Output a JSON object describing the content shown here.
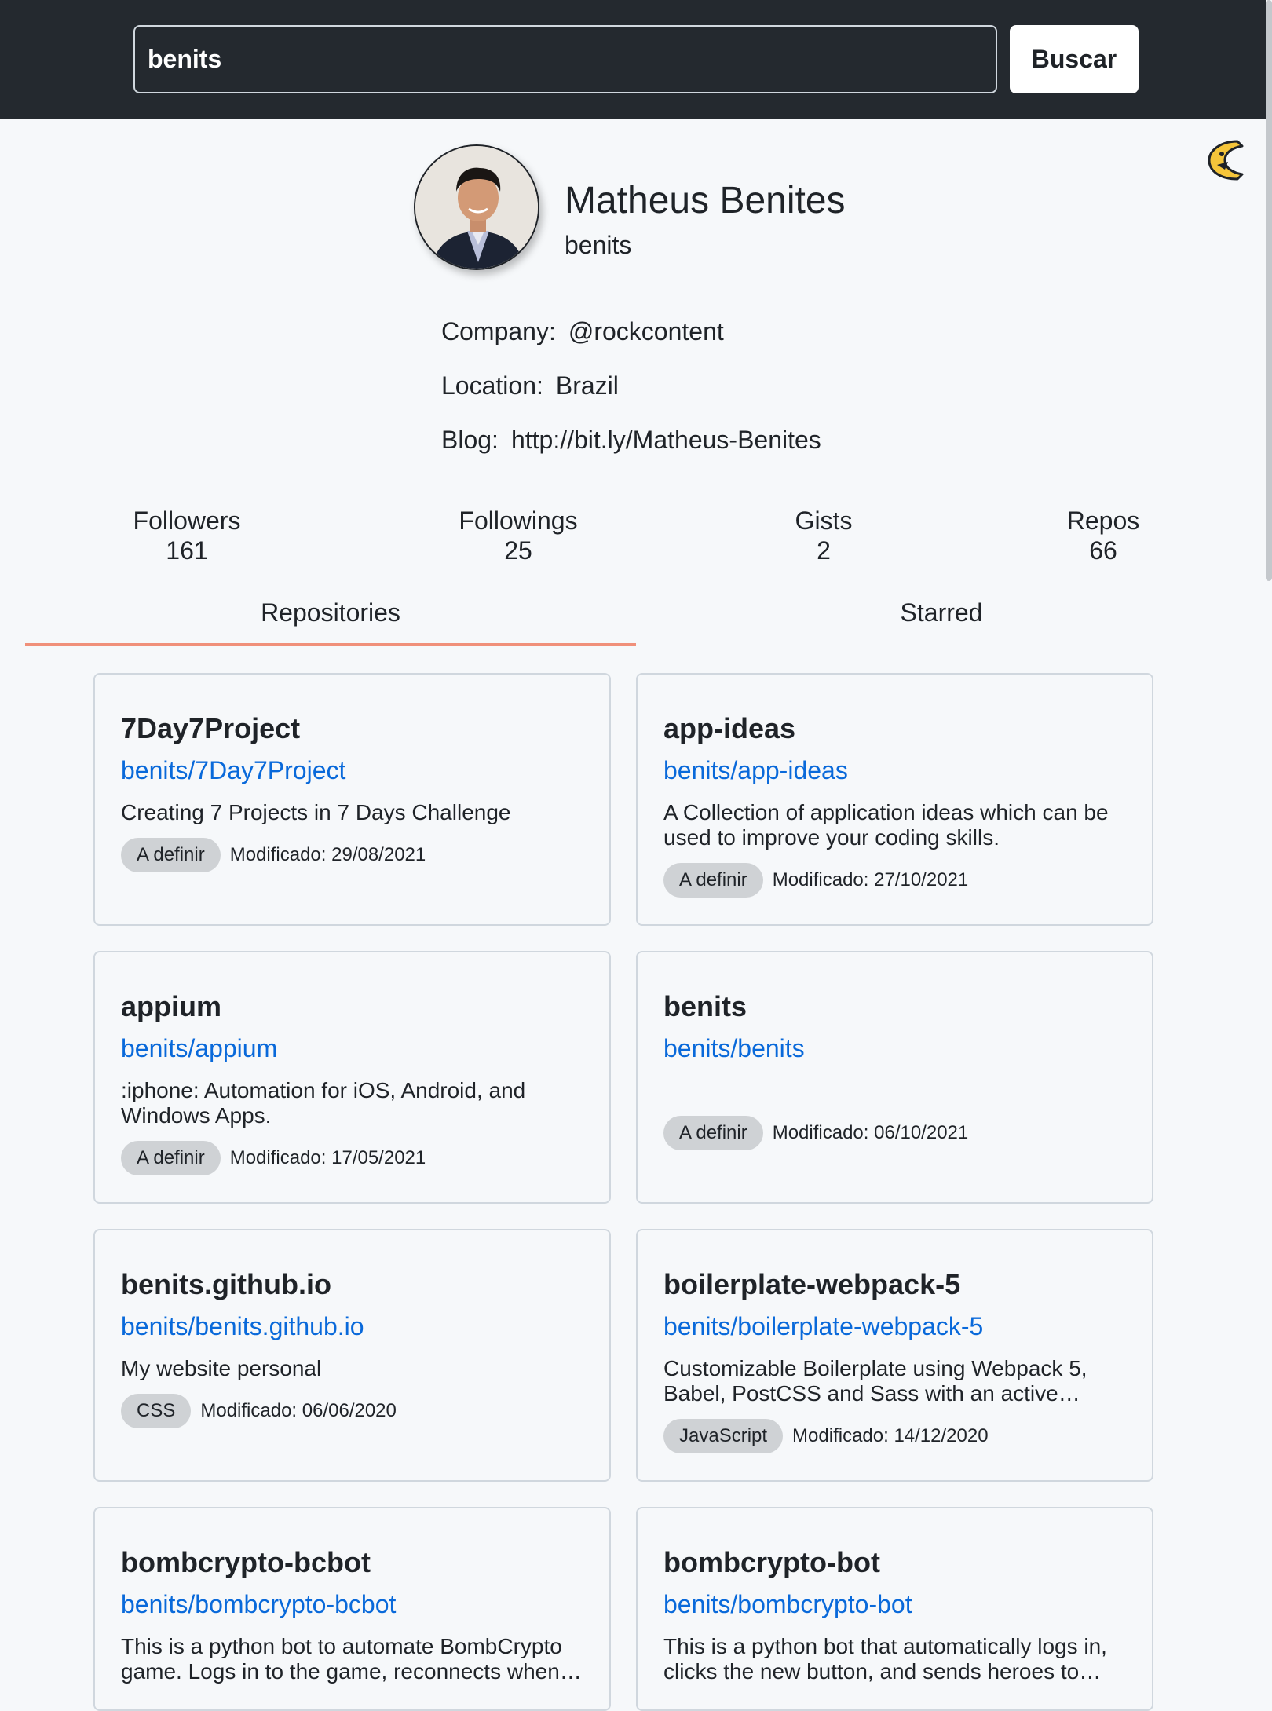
{
  "search": {
    "value": "benits",
    "button_label": "Buscar"
  },
  "profile": {
    "name": "Matheus Benites",
    "login": "benits",
    "company_label": "Company:",
    "company": "@rockcontent",
    "location_label": "Location:",
    "location": "Brazil",
    "blog_label": "Blog:",
    "blog": "http://bit.ly/Matheus-Benites"
  },
  "stats": [
    {
      "label": "Followers",
      "value": "161"
    },
    {
      "label": "Followings",
      "value": "25"
    },
    {
      "label": "Gists",
      "value": "2"
    },
    {
      "label": "Repos",
      "value": "66"
    }
  ],
  "tabs": [
    {
      "label": "Repositories",
      "active": true
    },
    {
      "label": "Starred",
      "active": false
    }
  ],
  "repos": [
    {
      "name": "7Day7Project",
      "full_name": "benits/7Day7Project",
      "description": "Creating 7 Projects in 7 Days Challenge",
      "language": "A definir",
      "modified": "Modificado: 29/08/2021"
    },
    {
      "name": "app-ideas",
      "full_name": "benits/app-ideas",
      "description": "A Collection of application ideas which can be used to improve your coding skills.",
      "language": "A definir",
      "modified": "Modificado: 27/10/2021"
    },
    {
      "name": "appium",
      "full_name": "benits/appium",
      "description": ":iphone: Automation for iOS, Android, and Windows Apps.",
      "language": "A definir",
      "modified": "Modificado: 17/05/2021"
    },
    {
      "name": "benits",
      "full_name": "benits/benits",
      "description": "",
      "language": "A definir",
      "modified": "Modificado: 06/10/2021"
    },
    {
      "name": "benits.github.io",
      "full_name": "benits/benits.github.io",
      "description": "My website personal",
      "language": "CSS",
      "modified": "Modificado: 06/06/2020"
    },
    {
      "name": "boilerplate-webpack-5",
      "full_name": "benits/boilerplate-webpack-5",
      "description": "Customizable Boilerplate using Webpack 5, Babel, PostCSS and Sass with an active…",
      "language": "JavaScript",
      "modified": "Modificado: 14/12/2020"
    },
    {
      "name": "bombcrypto-bcbot",
      "full_name": "benits/bombcrypto-bcbot",
      "description": "This is a python bot to automate BombCrypto game. Logs in to the game, reconnects when…",
      "language": "",
      "modified": ""
    },
    {
      "name": "bombcrypto-bot",
      "full_name": "benits/bombcrypto-bot",
      "description": "This is a python bot that automatically logs in, clicks the new button, and sends heroes to…",
      "language": "",
      "modified": ""
    }
  ],
  "icons": {
    "theme_toggle": "pacman-moon-icon",
    "avatar": "avatar-photo"
  },
  "colors": {
    "header_bg": "#24292f",
    "page_bg": "#f6f8fa",
    "link": "#0969da",
    "tab_underline": "#f0907a",
    "badge_bg": "#cfd2d5",
    "toggle_yellow": "#f5c53a"
  }
}
